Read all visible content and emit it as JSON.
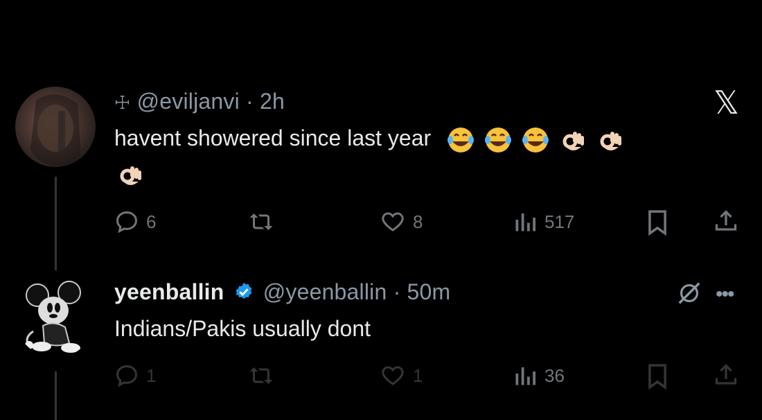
{
  "tweet1": {
    "prefix_glyph": "☩",
    "handle": "@eviljanvi",
    "separator": "·",
    "time": "2h",
    "text": "havent showered since last year",
    "emojis": [
      "laughing-tears",
      "laughing-tears",
      "laughing-tears",
      "ok-hand",
      "ok-hand",
      "ok-hand"
    ],
    "replies": "6",
    "likes": "8",
    "views": "517"
  },
  "tweet2": {
    "name": "yeenballin",
    "handle": "@yeenballin",
    "separator": "·",
    "time": "50m",
    "text": "Indians/Pakis usually dont",
    "replies": "1",
    "likes": "1",
    "views": "36"
  },
  "brand": {
    "logo": "𝕏"
  },
  "colors": {
    "background": "#000000",
    "text": "#e7e9ea",
    "muted": "#71767b",
    "verified": "#1d9bf0"
  }
}
